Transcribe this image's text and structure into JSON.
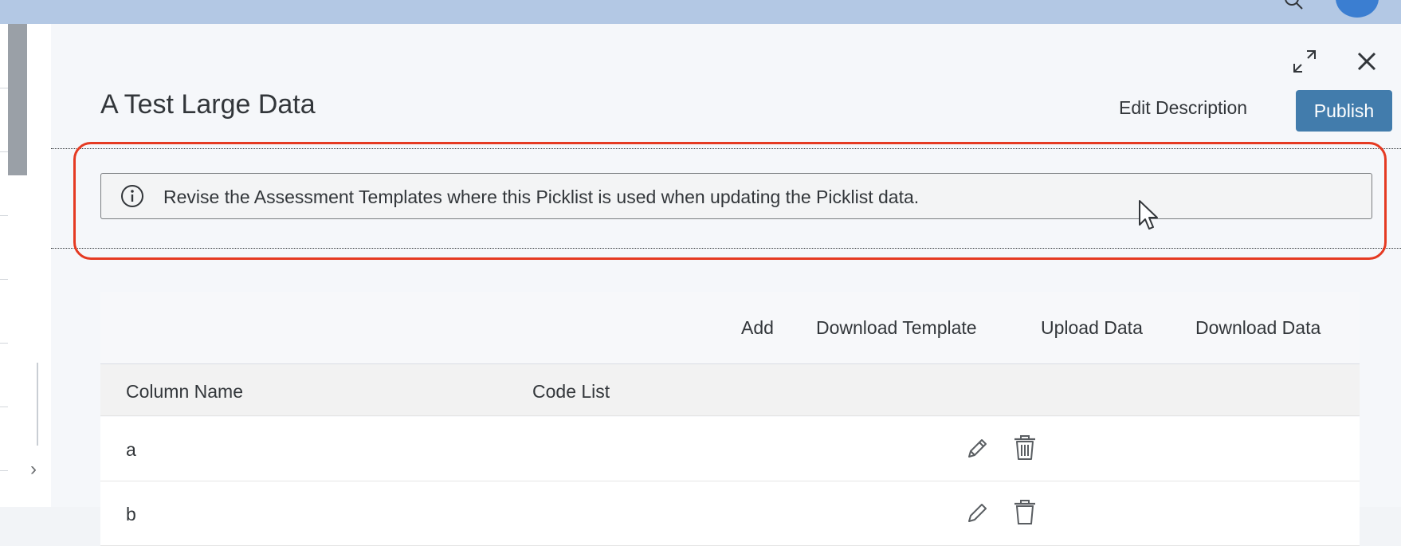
{
  "dialog": {
    "title": "A Test Large Data",
    "header_actions": {
      "edit_description_label": "Edit Description",
      "publish_label": "Publish"
    },
    "window_icons": [
      "expand-icon",
      "close-icon"
    ]
  },
  "info_strip": {
    "icon": "info-icon",
    "message": "Revise the Assessment Templates where this Picklist is used when updating the Picklist data."
  },
  "toolbar": {
    "add_label": "Add",
    "download_template_label": "Download Template",
    "upload_data_label": "Upload Data",
    "download_data_label": "Download Data"
  },
  "table": {
    "columns": [
      "Column Name",
      "Code List"
    ],
    "rows": [
      {
        "column_name": "a",
        "code_list": ""
      },
      {
        "column_name": "b",
        "code_list": ""
      }
    ],
    "row_actions": [
      "edit-icon",
      "delete-icon"
    ]
  },
  "colors": {
    "shell_bar": "#b3c8e4",
    "publish_button": "#427cac",
    "highlight_outline": "#e53a22",
    "avatar": "#3b7ed1"
  }
}
